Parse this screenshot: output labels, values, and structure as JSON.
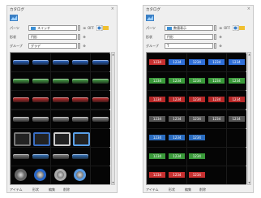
{
  "left_panel": {
    "title": "カタログ",
    "close_label": "×",
    "part_label": "パーツ",
    "part_value": "スイッチ",
    "part_buttons": [
      "⊞",
      "OFF"
    ],
    "shape_label": "形状",
    "shape_value": "円形",
    "group_label": "グループ",
    "group_value": "グラデ",
    "footer": [
      "アイテム",
      "形状",
      "編集",
      "削除"
    ],
    "cells": [
      {
        "kind": "button",
        "color": "#2f6fd8"
      },
      {
        "kind": "button",
        "color": "#2f6fd8"
      },
      {
        "kind": "button",
        "color": "#2f6fd8"
      },
      {
        "kind": "button",
        "color": "#2f6fd8"
      },
      {
        "kind": "button",
        "color": "#2f6fd8"
      },
      {
        "kind": "button",
        "color": "#4fb34f"
      },
      {
        "kind": "button",
        "color": "#4fb34f"
      },
      {
        "kind": "button",
        "color": "#4fb34f"
      },
      {
        "kind": "button",
        "color": "#4fb34f"
      },
      {
        "kind": "button",
        "color": "#4fb34f"
      },
      {
        "kind": "button",
        "color": "#d03030"
      },
      {
        "kind": "button",
        "color": "#d03030"
      },
      {
        "kind": "button",
        "color": "#d03030"
      },
      {
        "kind": "button",
        "color": "#d03030"
      },
      {
        "kind": "button",
        "color": "#d03030"
      },
      {
        "kind": "button",
        "color": "#999999"
      },
      {
        "kind": "button",
        "color": "#999999"
      },
      {
        "kind": "button",
        "color": "#999999"
      },
      {
        "kind": "button",
        "color": "#999999"
      },
      {
        "kind": "button",
        "color": "#999999"
      },
      {
        "kind": "frame",
        "color": "#777777"
      },
      {
        "kind": "frame",
        "color": "#3a6ec2"
      },
      {
        "kind": "frame",
        "color": "#cccccc"
      },
      {
        "kind": "frame",
        "color": "#5aa0e8"
      },
      {
        "kind": "empty",
        "color": "#050505"
      },
      {
        "kind": "button",
        "color": "#888888"
      },
      {
        "kind": "button",
        "color": "#3a80d0"
      },
      {
        "kind": "button",
        "color": "#888888"
      },
      {
        "kind": "button",
        "color": "#3a80d0"
      },
      {
        "kind": "empty",
        "color": "#050505"
      },
      {
        "kind": "circle",
        "color": "#666666"
      },
      {
        "kind": "circle",
        "color": "#2a68c8"
      },
      {
        "kind": "circle",
        "color": "#aaaaaa"
      },
      {
        "kind": "circle",
        "color": "#5a9ae0"
      },
      {
        "kind": "empty",
        "color": "#050505"
      }
    ]
  },
  "right_panel": {
    "title": "カタログ",
    "close_label": "×",
    "part_label": "パーツ",
    "part_value": "数値表示",
    "part_buttons": [
      "⊞",
      "OFF"
    ],
    "shape_label": "形状",
    "shape_value": "円形",
    "group_label": "グループ",
    "group_value": "T",
    "footer": [
      "アイテム",
      "形状",
      "編集",
      "削除"
    ],
    "cells": [
      {
        "text": "1234",
        "color": "#c83030"
      },
      {
        "text": "1234",
        "color": "#2f6fd8"
      },
      {
        "text": "1234",
        "color": "#2f6fd8"
      },
      {
        "text": "1234",
        "color": "#2f6fd8"
      },
      {
        "text": "1234",
        "color": "#2f6fd8"
      },
      {
        "text": "1234",
        "color": "#3a9a3a"
      },
      {
        "text": "1234",
        "color": "#3a9a3a"
      },
      {
        "text": "1234",
        "color": "#3a9a3a"
      },
      {
        "text": "1234",
        "color": "#3a9a3a"
      },
      {
        "text": "1234",
        "color": "#3a9a3a"
      },
      {
        "text": "1234",
        "color": "#b82828"
      },
      {
        "text": "1234",
        "color": "#b82828"
      },
      {
        "text": "1234",
        "color": "#b82828"
      },
      {
        "text": "1234",
        "color": "#b82828"
      },
      {
        "text": "1234",
        "color": "#b82828"
      },
      {
        "text": "1234",
        "color": "#555555"
      },
      {
        "text": "1234",
        "color": "#555555"
      },
      {
        "text": "1234",
        "color": "#555555"
      },
      {
        "text": "1234",
        "color": "#555555"
      },
      {
        "text": "1234",
        "color": "#555555"
      },
      {
        "text": "1234",
        "color": "#2a6cc0"
      },
      {
        "text": "1234",
        "color": "#2a6cc0"
      },
      {
        "text": "1234",
        "color": "#2a6cc0"
      },
      {
        "text": "",
        "color": "#050505"
      },
      {
        "text": "",
        "color": "#050505"
      },
      {
        "text": "1234",
        "color": "#3a9a3a"
      },
      {
        "text": "1234",
        "color": "#3a9a3a"
      },
      {
        "text": "1234",
        "color": "#3a9a3a"
      },
      {
        "text": "",
        "color": "#050505"
      },
      {
        "text": "",
        "color": "#050505"
      },
      {
        "text": "1234",
        "color": "#c83030"
      },
      {
        "text": "1234",
        "color": "#c83030"
      },
      {
        "text": "1234",
        "color": "#c83030"
      },
      {
        "text": "",
        "color": "#050505"
      },
      {
        "text": "",
        "color": "#050505"
      }
    ]
  }
}
